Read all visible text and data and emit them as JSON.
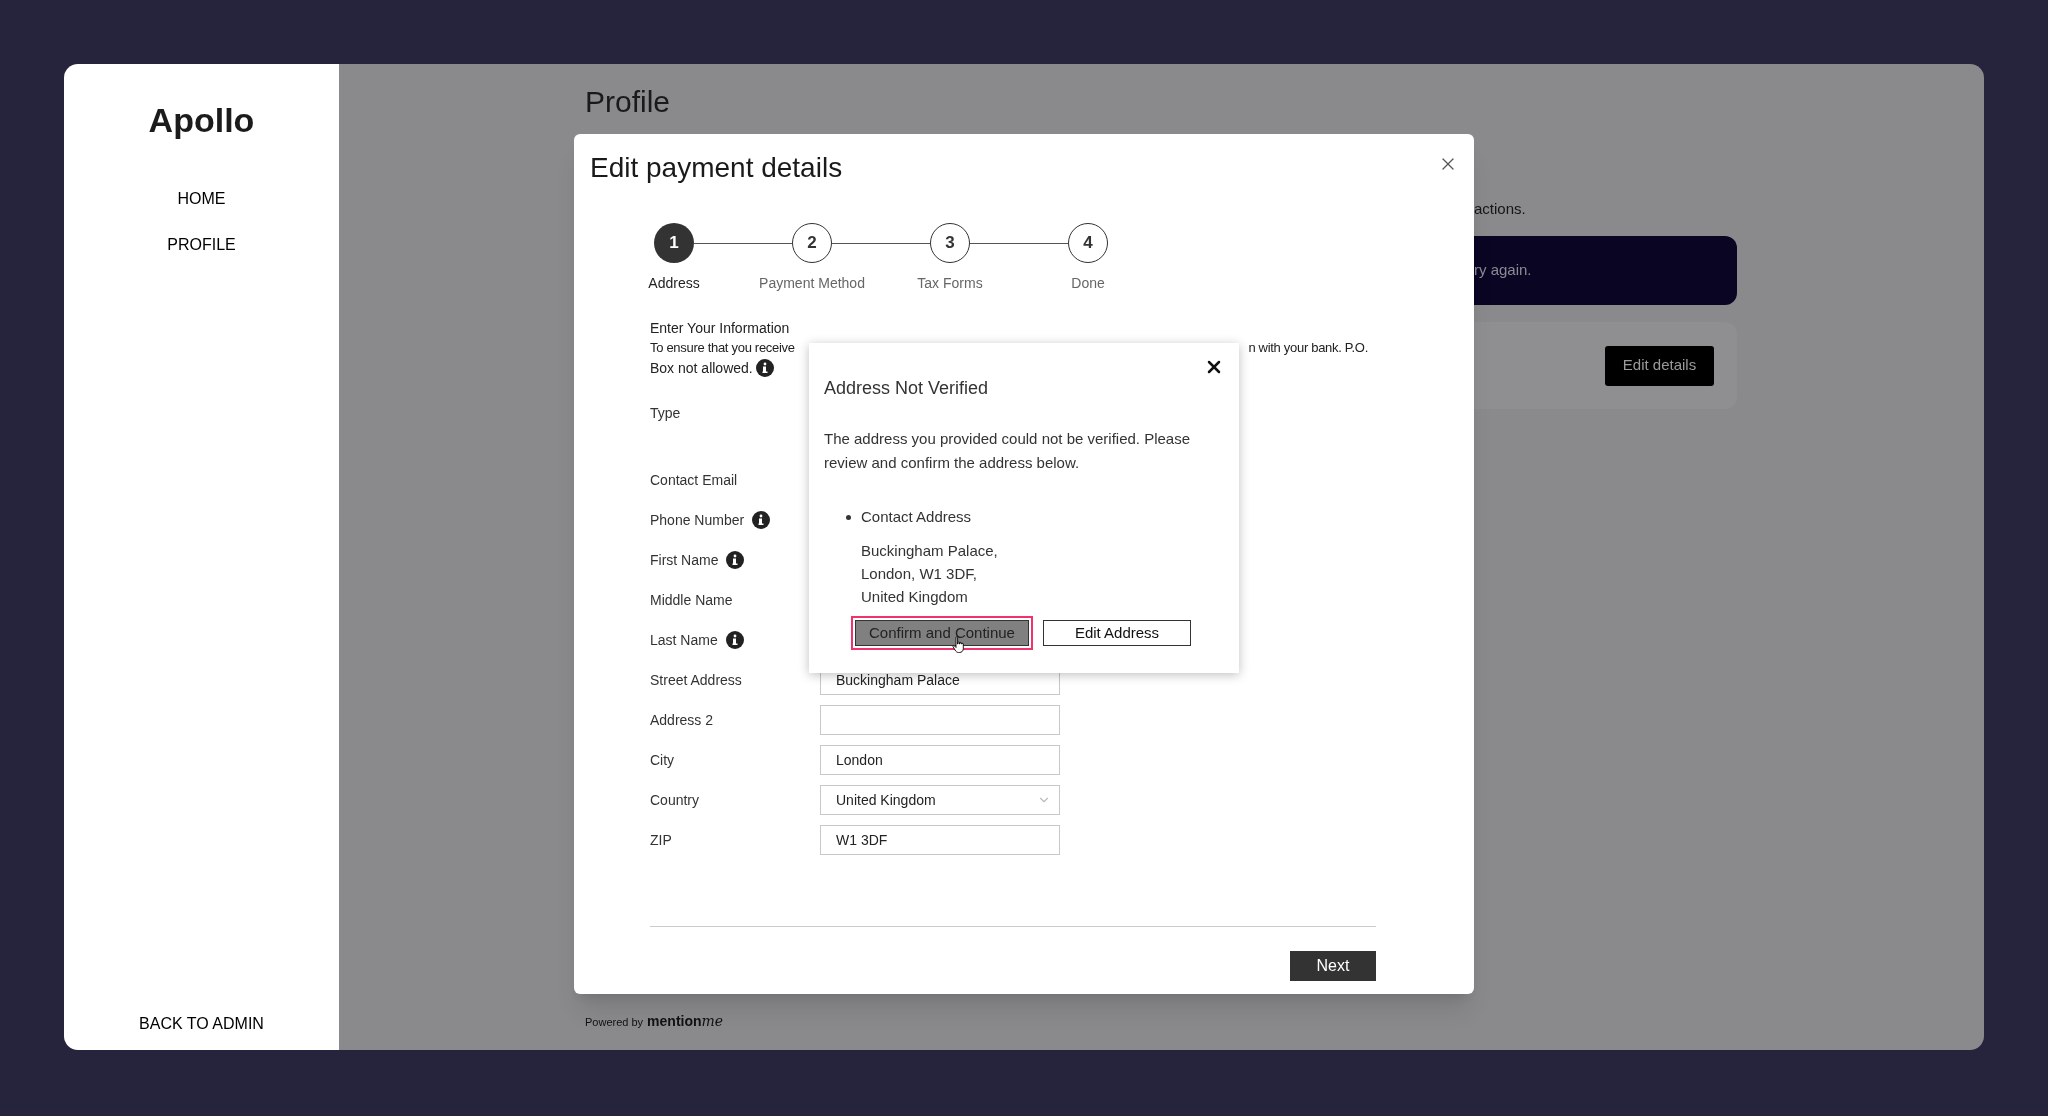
{
  "sidebar": {
    "logo": "Apollo",
    "items": [
      {
        "label": "HOME",
        "selected": false
      },
      {
        "label": "PROFILE",
        "selected": false
      }
    ],
    "footer_link": "BACK TO ADMIN"
  },
  "page": {
    "title": "Profile",
    "notice_fragment": "actions.",
    "banner_fragment": "ry again.",
    "card_button": "Edit details",
    "powered_by": "Powered by",
    "logo_main": "mention",
    "logo_script": "me"
  },
  "modal": {
    "title": "Edit payment details",
    "steps": [
      {
        "number": "1",
        "label": "Address",
        "selected": true
      },
      {
        "number": "2",
        "label": "Payment Method",
        "selected": false
      },
      {
        "number": "3",
        "label": "Tax Forms",
        "selected": false
      },
      {
        "number": "4",
        "label": "Done",
        "selected": false
      }
    ],
    "section_title": "Enter Your Information",
    "intro_left": "To ensure that you receive",
    "intro_right": "n with your bank. P.O.",
    "intro_line2": "Box not allowed.",
    "fields": [
      {
        "label": "Type",
        "info": false
      },
      {
        "label": "Contact Email",
        "info": false
      },
      {
        "label": "Phone Number",
        "info": true
      },
      {
        "label": "First Name",
        "info": true
      },
      {
        "label": "Middle Name",
        "info": false
      },
      {
        "label": "Last Name",
        "info": true
      },
      {
        "label": "Street Address",
        "info": false,
        "kind": "input",
        "value": "Buckingham Palace"
      },
      {
        "label": "Address 2",
        "info": false,
        "kind": "input"
      },
      {
        "label": "City",
        "info": false,
        "kind": "input",
        "value": "London"
      },
      {
        "label": "Country",
        "info": false,
        "kind": "select",
        "value": "United Kingdom"
      },
      {
        "label": "ZIP",
        "info": false,
        "kind": "input",
        "value": "W1 3DF"
      }
    ],
    "next_button": "Next"
  },
  "dialog": {
    "title": "Address Not Verified",
    "message": "The address you provided could not be verified. Please review and confirm the address below.",
    "address_heading": "Contact Address",
    "address_lines": [
      "Buckingham Palace,",
      "London, W1 3DF,",
      "United Kingdom"
    ],
    "buttons": [
      {
        "label": "Confirm and Continue",
        "kind": "primary",
        "focused": true
      },
      {
        "label": "Edit Address",
        "kind": "secondary",
        "focused": false
      }
    ]
  }
}
